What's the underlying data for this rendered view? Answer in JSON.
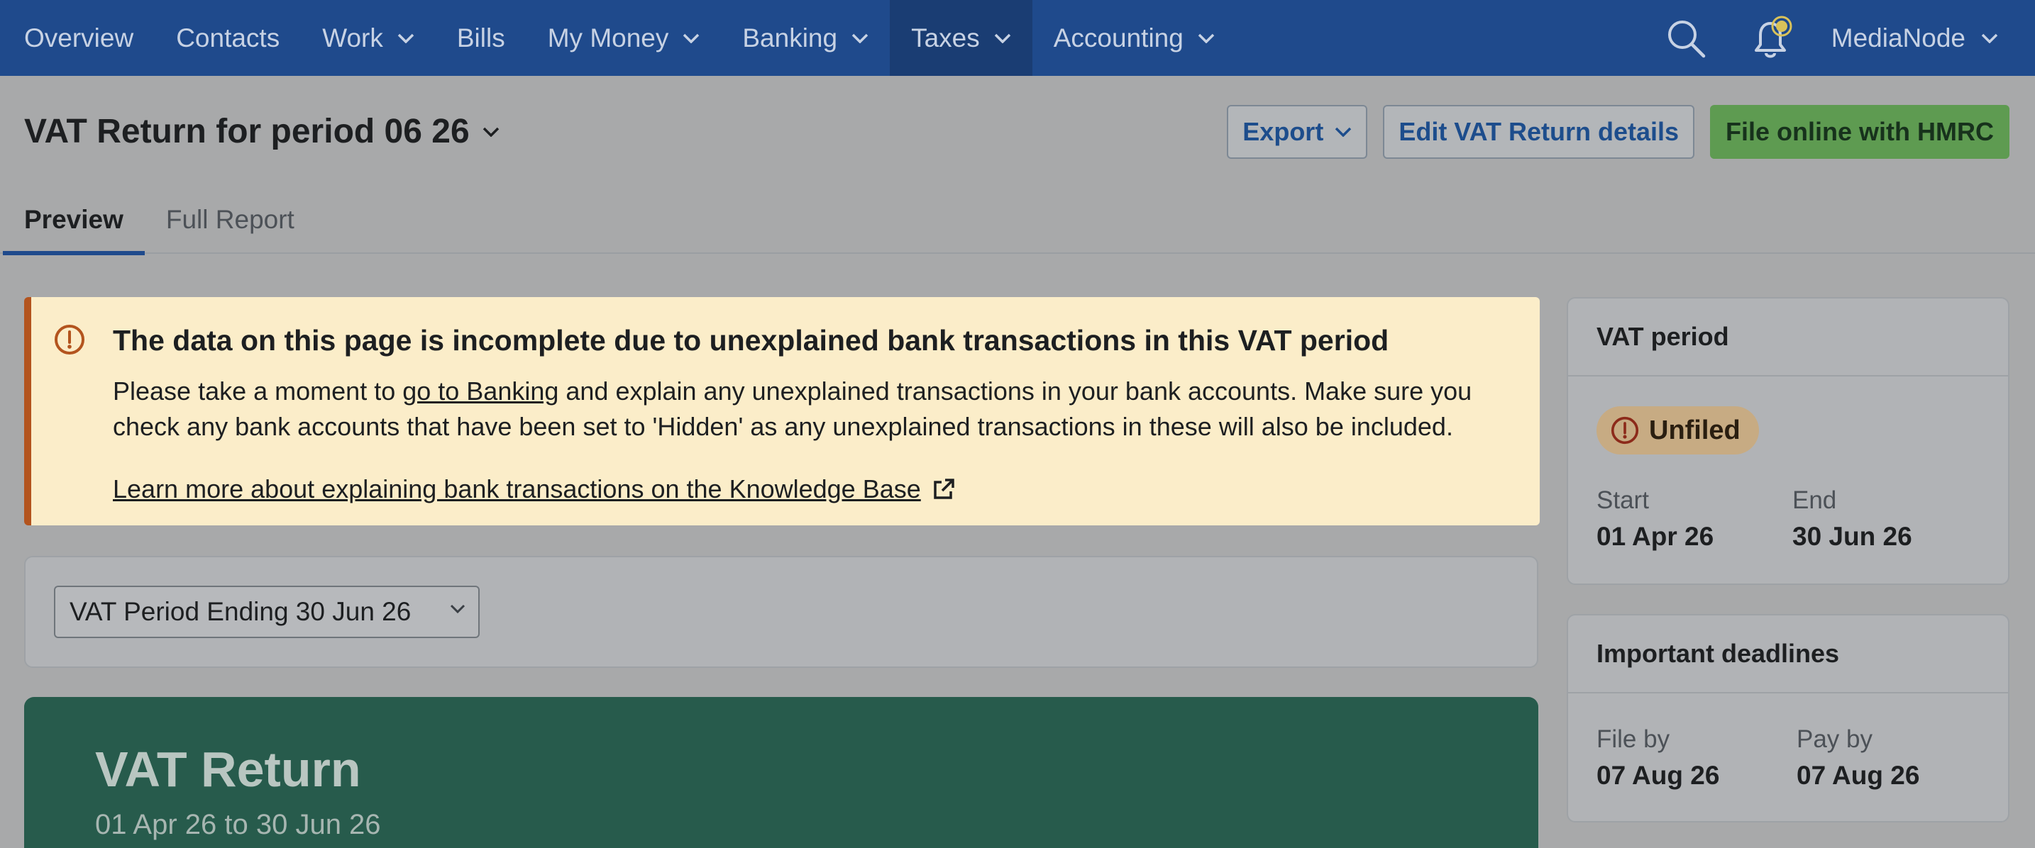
{
  "nav": {
    "items": [
      {
        "label": "Overview",
        "dropdown": false,
        "active": false
      },
      {
        "label": "Contacts",
        "dropdown": false,
        "active": false
      },
      {
        "label": "Work",
        "dropdown": true,
        "active": false
      },
      {
        "label": "Bills",
        "dropdown": false,
        "active": false
      },
      {
        "label": "My Money",
        "dropdown": true,
        "active": false
      },
      {
        "label": "Banking",
        "dropdown": true,
        "active": false
      },
      {
        "label": "Taxes",
        "dropdown": true,
        "active": true
      },
      {
        "label": "Accounting",
        "dropdown": true,
        "active": false
      }
    ],
    "search_icon": "search-icon",
    "notifications_icon": "bell-icon",
    "user_label": "MediaNode"
  },
  "header": {
    "title": "VAT Return for period 06 26",
    "export_label": "Export",
    "edit_label": "Edit VAT Return details",
    "file_label": "File online with HMRC"
  },
  "tabs": [
    {
      "label": "Preview",
      "active": true
    },
    {
      "label": "Full Report",
      "active": false
    }
  ],
  "alert": {
    "title": "The data on this page is incomplete due to unexplained bank transactions in this VAT period",
    "body_prefix": "Please take a moment to ",
    "body_link": "go to Banking",
    "body_suffix": " and explain any unexplained transactions in your bank accounts. Make sure you check any bank accounts that have been set to 'Hidden' as any unexplained transactions in these will also be included.",
    "kb_link": "Learn more about explaining bank transactions on the Knowledge Base"
  },
  "period_select": {
    "value": "VAT Period Ending 30 Jun 26"
  },
  "vat_return": {
    "title": "VAT Return",
    "range": "01 Apr 26 to 30 Jun 26"
  },
  "vat_period_card": {
    "heading": "VAT period",
    "status": "Unfiled",
    "start_label": "Start",
    "start_value": "01 Apr 26",
    "end_label": "End",
    "end_value": "30 Jun 26"
  },
  "deadlines_card": {
    "heading": "Important deadlines",
    "file_by_label": "File by",
    "file_by_value": "07 Aug 26",
    "pay_by_label": "Pay by",
    "pay_by_value": "07 Aug 26"
  },
  "colors": {
    "nav_bg": "#1f4a8c",
    "primary_button": "#5e9b51",
    "alert_bg": "#fbedc9",
    "alert_accent": "#b3541e",
    "vat_return_bg": "#275b4c"
  }
}
